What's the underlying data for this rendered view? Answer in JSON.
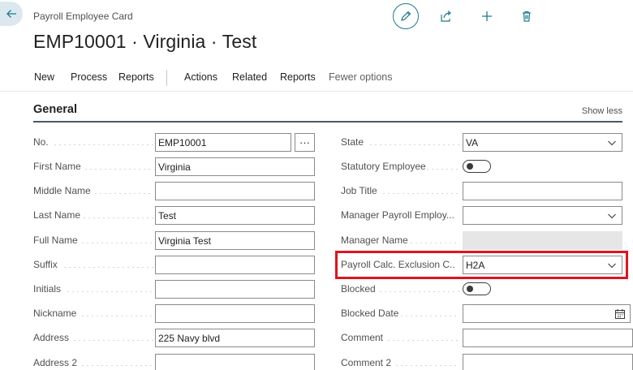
{
  "page": {
    "caption": "Payroll Employee Card",
    "title": "EMP10001 · Virginia · Test"
  },
  "top_actions": [
    {
      "name": "edit",
      "icon": "pencil-icon"
    },
    {
      "name": "share",
      "icon": "share-icon"
    },
    {
      "name": "new",
      "icon": "plus-icon"
    },
    {
      "name": "delete",
      "icon": "trash-icon"
    }
  ],
  "action_bar": {
    "new": "New",
    "process": "Process",
    "reports": "Reports",
    "actions": "Actions",
    "related": "Related",
    "reports2": "Reports",
    "fewer": "Fewer options"
  },
  "section": {
    "title": "General",
    "toggle": "Show less"
  },
  "left_fields": {
    "no": {
      "label": "No.",
      "value": "EMP10001",
      "assist": "···"
    },
    "first_name": {
      "label": "First Name",
      "value": "Virginia"
    },
    "middle_name": {
      "label": "Middle Name",
      "value": ""
    },
    "last_name": {
      "label": "Last Name",
      "value": "Test"
    },
    "full_name": {
      "label": "Full Name",
      "value": "Virginia Test"
    },
    "suffix": {
      "label": "Suffix",
      "value": ""
    },
    "initials": {
      "label": "Initials",
      "value": ""
    },
    "nickname": {
      "label": "Nickname",
      "value": ""
    },
    "address": {
      "label": "Address",
      "value": "225 Navy blvd"
    },
    "address2": {
      "label": "Address 2",
      "value": ""
    }
  },
  "right_fields": {
    "state": {
      "label": "State",
      "value": "VA"
    },
    "statutory": {
      "label": "Statutory Employee",
      "checked": false
    },
    "job_title": {
      "label": "Job Title",
      "value": ""
    },
    "manager_payroll": {
      "label": "Manager Payroll Employ...",
      "value": ""
    },
    "manager_name": {
      "label": "Manager Name",
      "value": ""
    },
    "exclusion": {
      "label": "Payroll Calc. Exclusion C...",
      "value": "H2A"
    },
    "blocked": {
      "label": "Blocked",
      "checked": false
    },
    "blocked_date": {
      "label": "Blocked Date",
      "value": ""
    },
    "comment": {
      "label": "Comment",
      "value": ""
    },
    "comment2": {
      "label": "Comment 2",
      "value": ""
    }
  },
  "colors": {
    "accent": "#1b7c8a",
    "highlight": "#e0141e",
    "section_rule": "#4b5a60"
  }
}
